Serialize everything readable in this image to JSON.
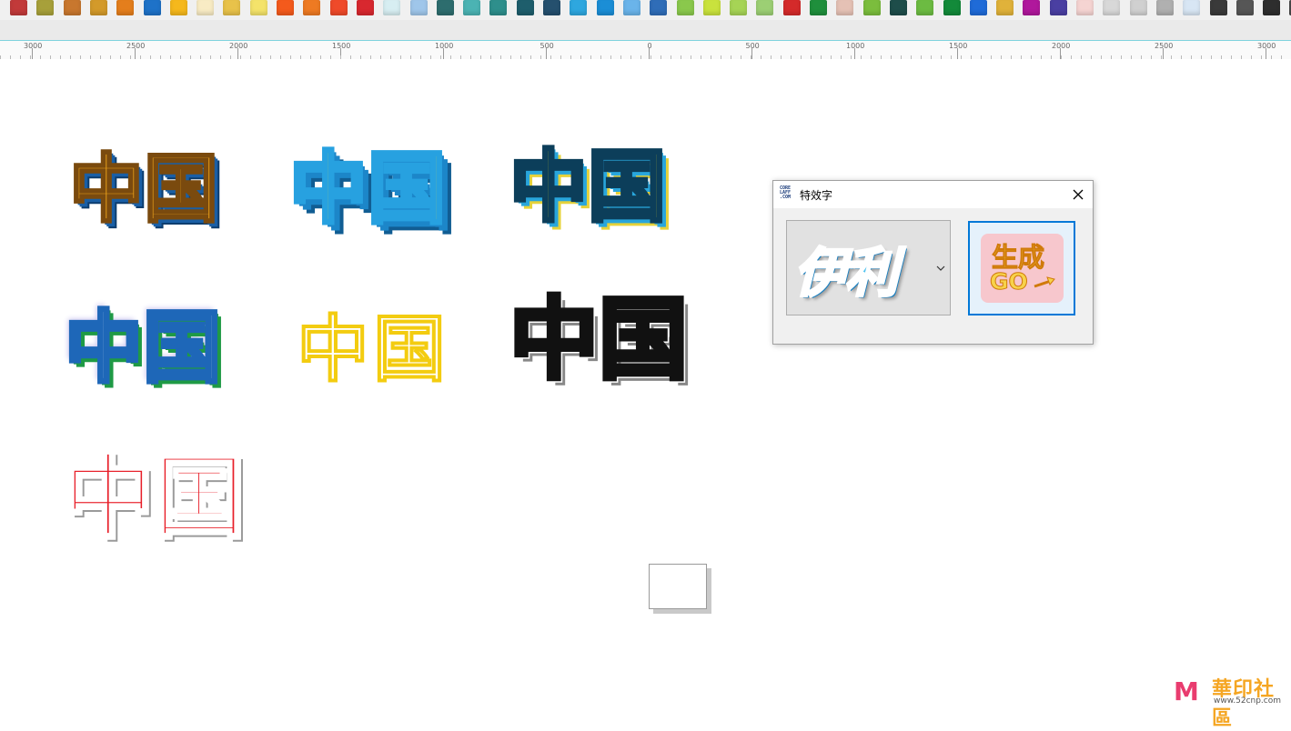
{
  "palette": {
    "colors": [
      "#c23a3a",
      "#a7a03a",
      "#c8772e",
      "#d39a2a",
      "#e47e1c",
      "#1e72c8",
      "#f5b81c",
      "#f8ebc4",
      "#e8c24a",
      "#f4e36a",
      "#f45a1c",
      "#ee7a22",
      "#ef4a2a",
      "#d8282f",
      "#d7eef2",
      "#9fc6ea",
      "#2d6d6e",
      "#4bb3b3",
      "#2e8f8c",
      "#1e5e6c",
      "#25506e",
      "#2ea7df",
      "#1b8ed6",
      "#6ab4ea",
      "#2f6db8",
      "#8ac84c",
      "#c9e23d",
      "#a6d455",
      "#9ccf74",
      "#d42a2a",
      "#1f8f3c",
      "#e5c1b5",
      "#7bbd3d",
      "#1e4d4a",
      "#6cbb42",
      "#138a3a",
      "#1f6bd8",
      "#e0b23a",
      "#b0189c",
      "#4a3fa2",
      "#f5d4d2",
      "#d8d8d8",
      "#d0d0d0",
      "#b0b0b0",
      "#d8e6f4",
      "#3a3a3a",
      "#565656",
      "#2e2e2e",
      "#4a4a4a"
    ]
  },
  "ruler": {
    "labels": [
      "3000",
      "2500",
      "2000",
      "1500",
      "1000",
      "500",
      "0",
      "500",
      "1000",
      "1500",
      "2000",
      "2500",
      "3000"
    ]
  },
  "artwork": {
    "glyph_pair": "中国",
    "samples": [
      {
        "name": "gold-blue-3d",
        "text_fill": "#f0a51c"
      },
      {
        "name": "yellow-blue-3d",
        "text_fill": "#ffe81a"
      },
      {
        "name": "yellow-teal-3d",
        "text_fill": "#ffe81a"
      },
      {
        "name": "white-green-3d",
        "text_fill": "#ffffff"
      },
      {
        "name": "yellow-outline",
        "text_fill": "#ffffff"
      },
      {
        "name": "black-white-outline",
        "text_fill": "#ffffff"
      },
      {
        "name": "red-white-3d",
        "text_fill": "#e8202a"
      }
    ]
  },
  "dialog": {
    "logo_text": "CORE LAFF .COM",
    "title": "特效字",
    "close_icon": "close-icon",
    "style_select": {
      "preview_text": "伊利",
      "chevron_icon": "chevron-down-icon"
    },
    "generate_button": {
      "line1": "生成",
      "line2": "GO"
    }
  },
  "watermark": {
    "logo": "M",
    "title": "華印社區",
    "url": "www.52cnp.com"
  }
}
